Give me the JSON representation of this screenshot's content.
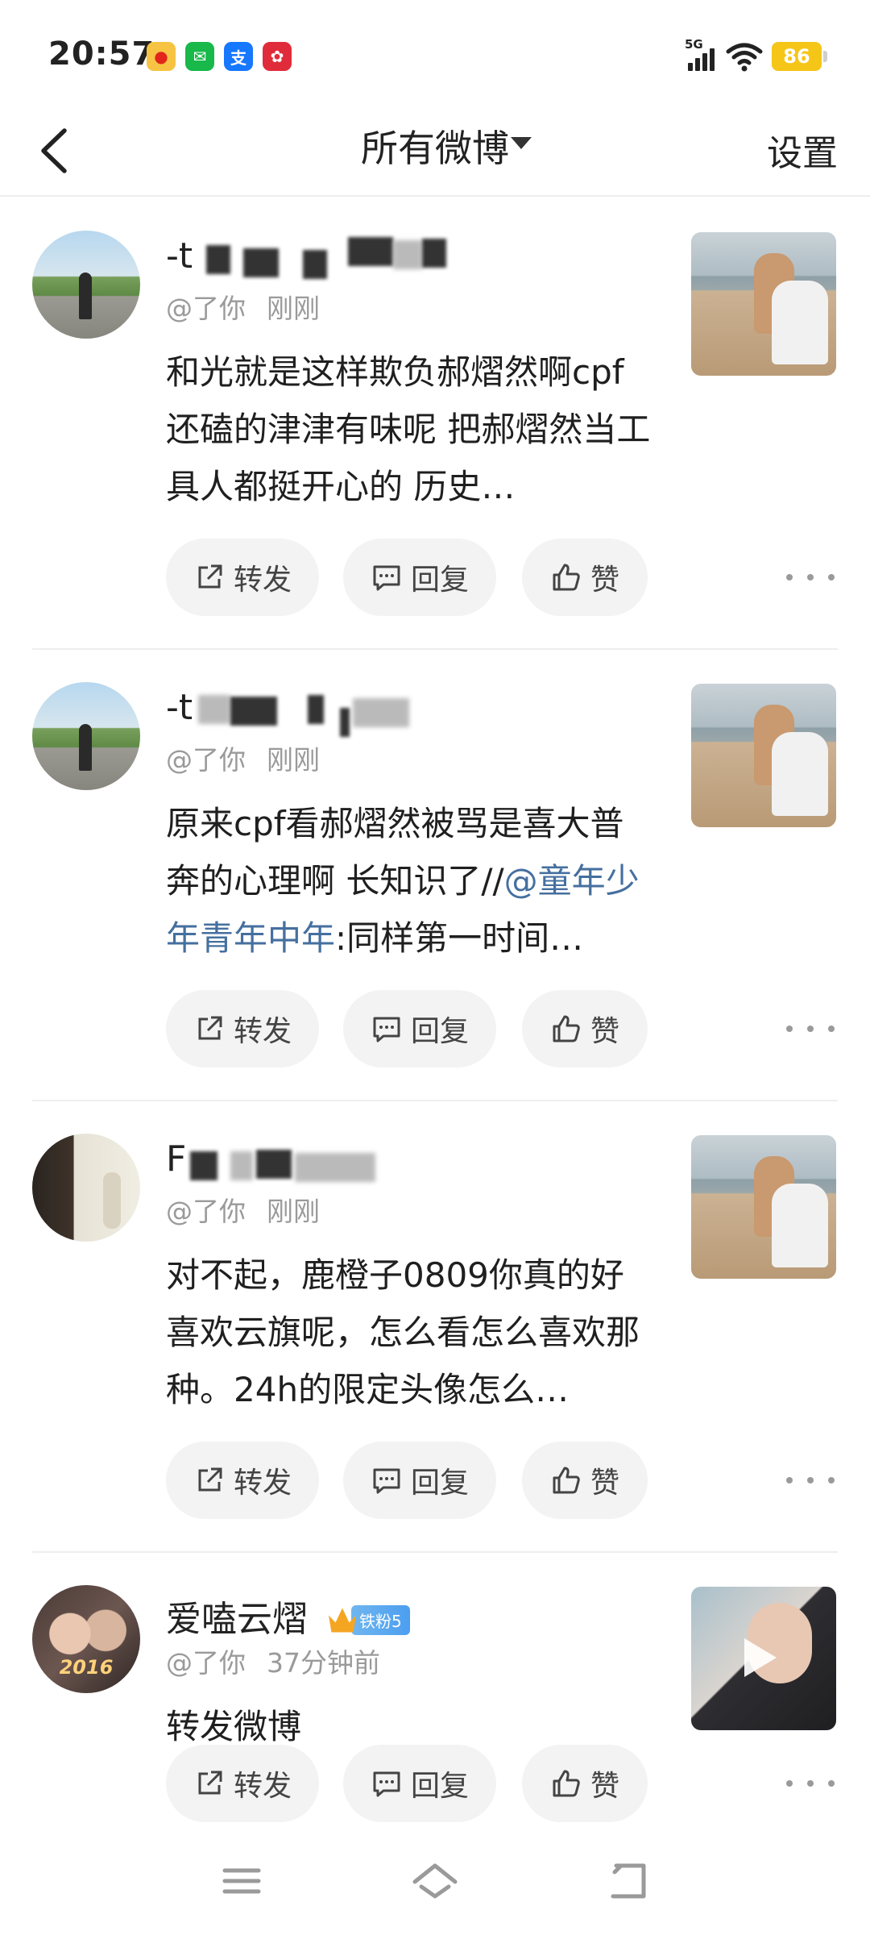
{
  "status_bar": {
    "time": "20:57",
    "network": "5G",
    "battery": "86",
    "app_icons": [
      "weibo-icon",
      "wechat-icon",
      "alipay-icon",
      "app-red-icon"
    ]
  },
  "header": {
    "title": "所有微博",
    "settings_label": "设置"
  },
  "actions": {
    "repost": "转发",
    "comment": "回复",
    "like": "赞"
  },
  "posts": [
    {
      "username": "-t",
      "handle": "@了你",
      "time": "刚刚",
      "text": "和光就是这样欺负郝熠然啊cpf还磕的津津有味呢 把郝熠然当工具人都挺开心的 历史…",
      "text_before_mention": "",
      "mention": "",
      "text_after_mention": "",
      "has_video": false
    },
    {
      "username": "-t",
      "handle": "@了你",
      "time": "刚刚",
      "text_before_mention": "原来cpf看郝熠然被骂是喜大普奔的心理啊 长知识了//",
      "mention": "@童年少年青年中年",
      "text_after_mention": ":同样第一时间…",
      "has_video": false
    },
    {
      "username": "F",
      "handle": "@了你",
      "time": "刚刚",
      "text": "对不起，鹿橙子0809你真的好喜欢云旗呢，怎么看怎么喜欢那种。24h的限定头像怎么…",
      "has_video": false
    },
    {
      "username": "爱嗑云熠",
      "badge": "铁粉5",
      "avatar_text": "2016",
      "handle": "@了你",
      "time": "37分钟前",
      "text": "转发微博",
      "has_video": true
    }
  ],
  "colors": {
    "mention": "#456f9f",
    "meta_text": "#9a9a9a",
    "action_bg": "#f3f3f3",
    "battery": "#f5c518",
    "fan_badge": "#4c9ef0"
  }
}
